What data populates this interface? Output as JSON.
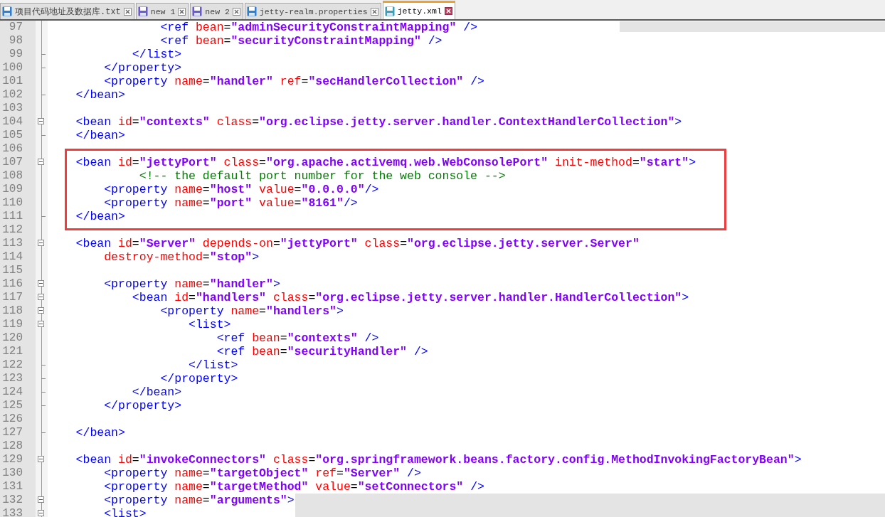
{
  "tabs": [
    {
      "label": "项目代码地址及数据库.txt",
      "selected": false,
      "color": "#2f7fd0"
    },
    {
      "label": "new 1",
      "selected": false,
      "color": "#6a5acd"
    },
    {
      "label": "new 2",
      "selected": false,
      "color": "#6a5acd"
    },
    {
      "label": "jetty-realm.properties",
      "selected": false,
      "color": "#2f7fd0"
    },
    {
      "label": "jetty.xml",
      "selected": true,
      "color": "#3aa0b8"
    }
  ],
  "lines": [
    {
      "no": "97",
      "kind": "plain",
      "highlighted": false,
      "tokens": [
        {
          "kind": "tag",
          "text": "                <ref"
        },
        {
          "kind": "attr",
          "text": " bean"
        },
        {
          "kind": "op",
          "text": "="
        },
        {
          "kind": "value",
          "text": "\"adminSecurityConstraintMapping\""
        },
        {
          "kind": "tag",
          "text": " />"
        }
      ]
    },
    {
      "no": "98",
      "kind": "plain",
      "highlighted": false,
      "tokens": [
        {
          "kind": "tag",
          "text": "                <ref"
        },
        {
          "kind": "attr",
          "text": " bean"
        },
        {
          "kind": "op",
          "text": "="
        },
        {
          "kind": "value",
          "text": "\"securityConstraintMapping\""
        },
        {
          "kind": "tag",
          "text": " />"
        }
      ]
    },
    {
      "no": "99",
      "kind": "fold_end",
      "highlighted": false,
      "tokens": [
        {
          "kind": "tag",
          "text": "            </list>"
        }
      ]
    },
    {
      "no": "100",
      "kind": "fold_end",
      "highlighted": false,
      "tokens": [
        {
          "kind": "tag",
          "text": "        </property>"
        }
      ]
    },
    {
      "no": "101",
      "kind": "plain",
      "highlighted": false,
      "tokens": [
        {
          "kind": "tag",
          "text": "        <property"
        },
        {
          "kind": "attr",
          "text": " name"
        },
        {
          "kind": "op",
          "text": "="
        },
        {
          "kind": "value",
          "text": "\"handler\""
        },
        {
          "kind": "attr",
          "text": " ref"
        },
        {
          "kind": "op",
          "text": "="
        },
        {
          "kind": "value",
          "text": "\"secHandlerCollection\""
        },
        {
          "kind": "tag",
          "text": " />"
        }
      ]
    },
    {
      "no": "102",
      "kind": "fold_end",
      "highlighted": false,
      "tokens": [
        {
          "kind": "tag",
          "text": "    </bean>"
        }
      ]
    },
    {
      "no": "103",
      "kind": "plain",
      "highlighted": false
    },
    {
      "no": "104",
      "kind": "fold_start",
      "highlighted": false,
      "tokens": [
        {
          "kind": "tag",
          "text": "    <bean"
        },
        {
          "kind": "attr",
          "text": " id"
        },
        {
          "kind": "op",
          "text": "="
        },
        {
          "kind": "value",
          "text": "\"contexts\""
        },
        {
          "kind": "attr",
          "text": " class"
        },
        {
          "kind": "op",
          "text": "="
        },
        {
          "kind": "value",
          "text": "\"org.eclipse.jetty.server.handler.ContextHandlerCollection\""
        },
        {
          "kind": "tag",
          "text": ">"
        }
      ]
    },
    {
      "no": "105",
      "kind": "fold_end",
      "highlighted": false,
      "tokens": [
        {
          "kind": "tag",
          "text": "    </bean>"
        }
      ]
    },
    {
      "no": "106",
      "kind": "plain",
      "highlighted": false
    },
    {
      "no": "107",
      "kind": "fold_start",
      "highlighted": true,
      "tokens": [
        {
          "kind": "tag",
          "text": "    <bean"
        },
        {
          "kind": "attr",
          "text": " id"
        },
        {
          "kind": "op",
          "text": "="
        },
        {
          "kind": "value",
          "text": "\"jettyPort\""
        },
        {
          "kind": "attr",
          "text": " class"
        },
        {
          "kind": "op",
          "text": "="
        },
        {
          "kind": "value",
          "text": "\"org.apache.activemq.web.WebConsolePort\""
        },
        {
          "kind": "attr",
          "text": " init-method"
        },
        {
          "kind": "op",
          "text": "="
        },
        {
          "kind": "value",
          "text": "\"start\""
        },
        {
          "kind": "tag",
          "text": ">"
        }
      ]
    },
    {
      "no": "108",
      "kind": "plain",
      "highlighted": true,
      "tokens": [
        {
          "kind": "comment",
          "text": "             <!-- the default port number for the web console -->"
        }
      ]
    },
    {
      "no": "109",
      "kind": "plain",
      "highlighted": true,
      "tokens": [
        {
          "kind": "tag",
          "text": "        <property"
        },
        {
          "kind": "attr",
          "text": " name"
        },
        {
          "kind": "op",
          "text": "="
        },
        {
          "kind": "value",
          "text": "\"host\""
        },
        {
          "kind": "attr",
          "text": " value"
        },
        {
          "kind": "op",
          "text": "="
        },
        {
          "kind": "value",
          "text": "\"0.0.0.0\""
        },
        {
          "kind": "tag",
          "text": "/>"
        }
      ]
    },
    {
      "no": "110",
      "kind": "plain",
      "highlighted": true,
      "tokens": [
        {
          "kind": "tag",
          "text": "        <property"
        },
        {
          "kind": "attr",
          "text": " name"
        },
        {
          "kind": "op",
          "text": "="
        },
        {
          "kind": "value",
          "text": "\"port\""
        },
        {
          "kind": "attr",
          "text": " value"
        },
        {
          "kind": "op",
          "text": "="
        },
        {
          "kind": "value",
          "text": "\"8161\""
        },
        {
          "kind": "tag",
          "text": "/>"
        }
      ]
    },
    {
      "no": "111",
      "kind": "fold_end",
      "highlighted": true,
      "tokens": [
        {
          "kind": "tag",
          "text": "    </bean>"
        }
      ]
    },
    {
      "no": "112",
      "kind": "plain",
      "highlighted": false
    },
    {
      "no": "113",
      "kind": "fold_start",
      "highlighted": false,
      "tokens": [
        {
          "kind": "tag",
          "text": "    <bean"
        },
        {
          "kind": "attr",
          "text": " id"
        },
        {
          "kind": "op",
          "text": "="
        },
        {
          "kind": "value",
          "text": "\"Server\""
        },
        {
          "kind": "attr",
          "text": " depends-on"
        },
        {
          "kind": "op",
          "text": "="
        },
        {
          "kind": "value",
          "text": "\"jettyPort\""
        },
        {
          "kind": "attr",
          "text": " class"
        },
        {
          "kind": "op",
          "text": "="
        },
        {
          "kind": "value",
          "text": "\"org.eclipse.jetty.server.Server\""
        }
      ]
    },
    {
      "no": "114",
      "kind": "plain",
      "highlighted": false,
      "tokens": [
        {
          "kind": "attr",
          "text": "        destroy-method"
        },
        {
          "kind": "op",
          "text": "="
        },
        {
          "kind": "value",
          "text": "\"stop\""
        },
        {
          "kind": "tag",
          "text": ">"
        }
      ]
    },
    {
      "no": "115",
      "kind": "plain",
      "highlighted": false
    },
    {
      "no": "116",
      "kind": "fold_start",
      "highlighted": false,
      "tokens": [
        {
          "kind": "tag",
          "text": "        <property"
        },
        {
          "kind": "attr",
          "text": " name"
        },
        {
          "kind": "op",
          "text": "="
        },
        {
          "kind": "value",
          "text": "\"handler\""
        },
        {
          "kind": "tag",
          "text": ">"
        }
      ]
    },
    {
      "no": "117",
      "kind": "fold_start",
      "highlighted": false,
      "tokens": [
        {
          "kind": "tag",
          "text": "            <bean"
        },
        {
          "kind": "attr",
          "text": " id"
        },
        {
          "kind": "op",
          "text": "="
        },
        {
          "kind": "value",
          "text": "\"handlers\""
        },
        {
          "kind": "attr",
          "text": " class"
        },
        {
          "kind": "op",
          "text": "="
        },
        {
          "kind": "value",
          "text": "\"org.eclipse.jetty.server.handler.HandlerCollection\""
        },
        {
          "kind": "tag",
          "text": ">"
        }
      ]
    },
    {
      "no": "118",
      "kind": "fold_start",
      "highlighted": false,
      "tokens": [
        {
          "kind": "tag",
          "text": "                <property"
        },
        {
          "kind": "attr",
          "text": " name"
        },
        {
          "kind": "op",
          "text": "="
        },
        {
          "kind": "value",
          "text": "\"handlers\""
        },
        {
          "kind": "tag",
          "text": ">"
        }
      ]
    },
    {
      "no": "119",
      "kind": "fold_start",
      "highlighted": false,
      "tokens": [
        {
          "kind": "tag",
          "text": "                    <list>"
        }
      ]
    },
    {
      "no": "120",
      "kind": "plain",
      "highlighted": false,
      "tokens": [
        {
          "kind": "tag",
          "text": "                        <ref"
        },
        {
          "kind": "attr",
          "text": " bean"
        },
        {
          "kind": "op",
          "text": "="
        },
        {
          "kind": "value",
          "text": "\"contexts\""
        },
        {
          "kind": "tag",
          "text": " />"
        }
      ]
    },
    {
      "no": "121",
      "kind": "plain",
      "highlighted": false,
      "tokens": [
        {
          "kind": "tag",
          "text": "                        <ref"
        },
        {
          "kind": "attr",
          "text": " bean"
        },
        {
          "kind": "op",
          "text": "="
        },
        {
          "kind": "value",
          "text": "\"securityHandler\""
        },
        {
          "kind": "tag",
          "text": " />"
        }
      ]
    },
    {
      "no": "122",
      "kind": "fold_end",
      "highlighted": false,
      "tokens": [
        {
          "kind": "tag",
          "text": "                    </list>"
        }
      ]
    },
    {
      "no": "123",
      "kind": "fold_end",
      "highlighted": false,
      "tokens": [
        {
          "kind": "tag",
          "text": "                </property>"
        }
      ]
    },
    {
      "no": "124",
      "kind": "fold_end",
      "highlighted": false,
      "tokens": [
        {
          "kind": "tag",
          "text": "            </bean>"
        }
      ]
    },
    {
      "no": "125",
      "kind": "fold_end",
      "highlighted": false,
      "tokens": [
        {
          "kind": "tag",
          "text": "        </property>"
        }
      ]
    },
    {
      "no": "126",
      "kind": "plain",
      "highlighted": false
    },
    {
      "no": "127",
      "kind": "fold_end",
      "highlighted": false,
      "tokens": [
        {
          "kind": "tag",
          "text": "    </bean>"
        }
      ]
    },
    {
      "no": "128",
      "kind": "plain",
      "highlighted": false
    },
    {
      "no": "129",
      "kind": "fold_start",
      "highlighted": false,
      "tokens": [
        {
          "kind": "tag",
          "text": "    <bean"
        },
        {
          "kind": "attr",
          "text": " id"
        },
        {
          "kind": "op",
          "text": "="
        },
        {
          "kind": "value",
          "text": "\"invokeConnectors\""
        },
        {
          "kind": "attr",
          "text": " class"
        },
        {
          "kind": "op",
          "text": "="
        },
        {
          "kind": "value",
          "text": "\"org.springframework.beans.factory.config.MethodInvokingFactoryBean\""
        },
        {
          "kind": "tag",
          "text": ">"
        }
      ]
    },
    {
      "no": "130",
      "kind": "plain",
      "highlighted": false,
      "tokens": [
        {
          "kind": "tag",
          "text": "        <property"
        },
        {
          "kind": "attr",
          "text": " name"
        },
        {
          "kind": "op",
          "text": "="
        },
        {
          "kind": "value",
          "text": "\"targetObject\""
        },
        {
          "kind": "attr",
          "text": " ref"
        },
        {
          "kind": "op",
          "text": "="
        },
        {
          "kind": "value",
          "text": "\"Server\""
        },
        {
          "kind": "tag",
          "text": " />"
        }
      ]
    },
    {
      "no": "131",
      "kind": "plain",
      "highlighted": false,
      "tokens": [
        {
          "kind": "tag",
          "text": "        <property"
        },
        {
          "kind": "attr",
          "text": " name"
        },
        {
          "kind": "op",
          "text": "="
        },
        {
          "kind": "value",
          "text": "\"targetMethod\""
        },
        {
          "kind": "attr",
          "text": " value"
        },
        {
          "kind": "op",
          "text": "="
        },
        {
          "kind": "value",
          "text": "\"setConnectors\""
        },
        {
          "kind": "tag",
          "text": " />"
        }
      ]
    },
    {
      "no": "132",
      "kind": "fold_start",
      "highlighted": false,
      "tokens": [
        {
          "kind": "tag",
          "text": "        <property"
        },
        {
          "kind": "attr",
          "text": " name"
        },
        {
          "kind": "op",
          "text": "="
        },
        {
          "kind": "value",
          "text": "\"arguments\""
        },
        {
          "kind": "tag",
          "text": ">"
        }
      ]
    },
    {
      "no": "133",
      "kind": "fold_start",
      "highlighted": false,
      "tokens": [
        {
          "kind": "tag",
          "text": "        <list>"
        }
      ]
    }
  ]
}
